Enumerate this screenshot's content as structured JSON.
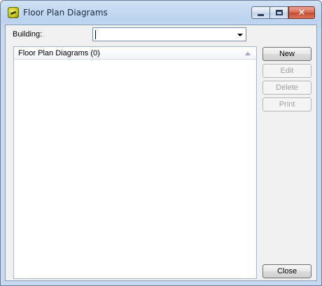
{
  "window": {
    "title": "Floor Plan Diagrams",
    "icon": "floor-plan-app-icon"
  },
  "building": {
    "label": "Building:",
    "value": ""
  },
  "list": {
    "header": "Floor Plan Diagrams (0)",
    "items": []
  },
  "buttons": {
    "new": "New",
    "edit": "Edit",
    "delete": "Delete",
    "print": "Print",
    "close": "Close"
  }
}
